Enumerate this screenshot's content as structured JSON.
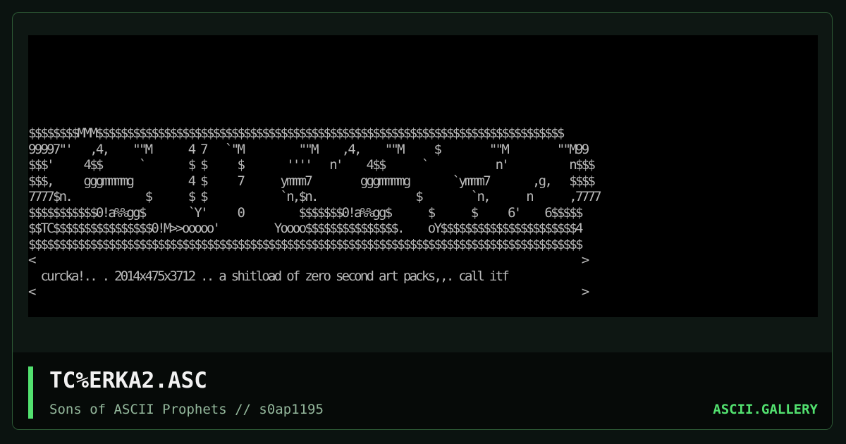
{
  "artwork": {
    "lines": [
      "$$$$$$$$MMM$$$$$$$$$$$$$$$$$$$$$$$$$$$$$$$$$$$$$$$$$$$$$$$$$$$$$$$$$$$$$$$$$$$$$$$$$$$$",
      "99997\"'   ,4,    \"\"M      4 7   `\"M         \"\"M    ,4,    \"\"M     $        \"\"M        \"\"M99",
      "$$$'     4$$      `       $ $     $       ''''   n'    4$$      `           n'          n$$$",
      "$$$,     gggmmmmg         4 $     7      ymmm7        gggmmmmg       `ymmm7       ,g,   $$$$",
      "7777$n.            $      $ $            `n,$n.                $        `n,      n      ,7777",
      "$$$$$$$$$$$0!a%%gg$       `Y'     0         $$$$$$$0!a%%gg$      $      $     6'    6$$$$$",
      "$$TC$$$$$$$$$$$$$$$$0!M>>ooooo'         Yoooo$$$$$$$$$$$$$$$.    oY$$$$$$$$$$$$$$$$$$$$$$4",
      "$$$$$$$$$$$$$$$$$$$$$$$$$$$$$$$$$$$$$$$$$$$$$$$$$$$$$$$$$$$$$$$$$$$$$$$$$$$$$$$$$$$$$$$$$$",
      "<                                                                                         >",
      "  curcka!.. . 2014x475x3712 .. a shitload of zero second art packs,,. call itf",
      "<                                                                                         >"
    ]
  },
  "file": {
    "title": "TC%ERKA2.ASC",
    "credit": "Sons of ASCII Prophets // s0ap1195"
  },
  "brand": {
    "name": "ASCII.GALLERY"
  },
  "colors": {
    "accent": "#52e16f",
    "art_text": "#b9b9b9",
    "background": "#0b1310"
  }
}
